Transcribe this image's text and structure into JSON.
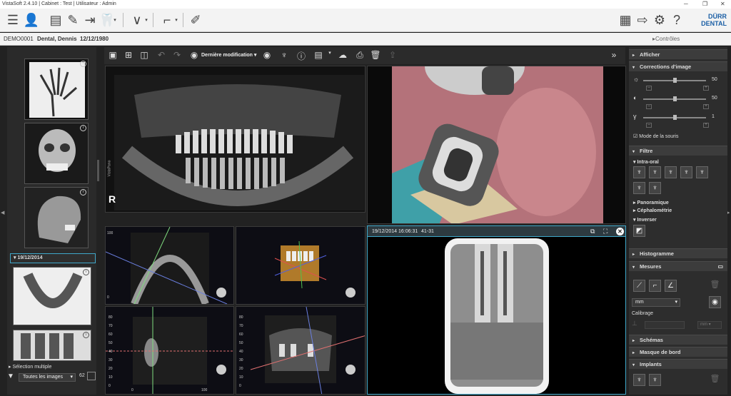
{
  "window": {
    "title": "VistaSoft 2.4.10 | Cabinet : Test | Utilisateur : Admin",
    "controls": [
      "minimize-icon",
      "maximize-icon",
      "close-icon"
    ]
  },
  "patient": {
    "id": "DEMO0001",
    "name": "Dental, Dennis",
    "dob": "12/12/1980",
    "controls_link": "Contrôles à échéance"
  },
  "brand": {
    "line1": "DÜRR",
    "line2": "DENTAL"
  },
  "view_toolbar": {
    "sort_label": "Dernière modification"
  },
  "left_panel": {
    "date_group": "19/12/2014",
    "multi_select": "Sélection multiple",
    "filter_value": "Toutes les images",
    "count": "62"
  },
  "panoramic": {
    "side_label": "R",
    "vertical_label": "VistaPano"
  },
  "xray_viewer": {
    "timestamp": "19/12/2014 16:06:31",
    "tooth": "41-31"
  },
  "right_panel": {
    "afficher": "Afficher",
    "corrections": "Corrections d'image",
    "brightness_value": "50",
    "contrast_value": "50",
    "gamma_value": "1",
    "mouse_mode": "Mode de la souris",
    "filtre": "Filtre",
    "intra_oral": "Intra-oral",
    "panoramique": "Panoramique",
    "cephalometrie": "Céphalométrie",
    "inverser": "Inverser",
    "histogramme": "Histogramme",
    "mesures": "Mesures",
    "unit_value": "mm",
    "calibrage": "Calibrage",
    "calib_unit": "mm",
    "schemas": "Schémas",
    "masque": "Masque de bord",
    "implants": "Implants"
  },
  "ct_views": {
    "axis_top_left": [
      "100",
      "0"
    ],
    "axis_left": [
      "80",
      "70",
      "60",
      "50",
      "40",
      "30",
      "20",
      "10",
      "0"
    ],
    "axis_bottom": [
      "0",
      "100"
    ],
    "axis_right": [
      "80",
      "70",
      "60",
      "50",
      "40",
      "30",
      "20",
      "10",
      "0"
    ]
  },
  "colors": {
    "accent": "#3fa7c9",
    "panel": "#2d2d2d",
    "section": "#3c3c3c"
  }
}
